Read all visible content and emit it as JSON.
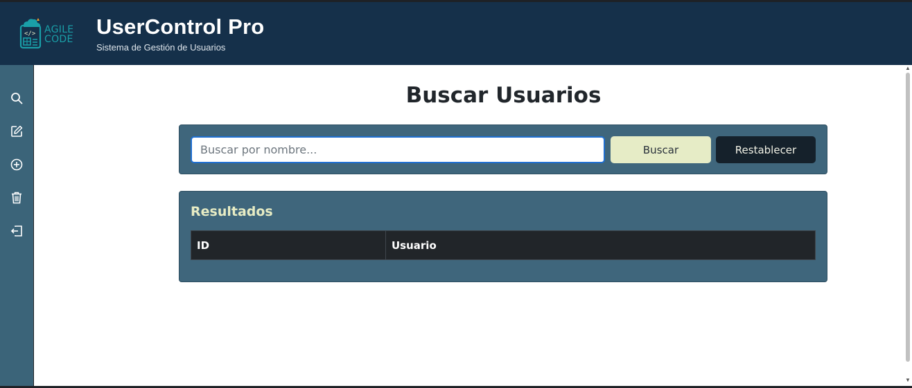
{
  "header": {
    "logo_line1": "AGILE",
    "logo_line2": "CODE",
    "title": "UserControl Pro",
    "subtitle": "Sistema de Gestión de Usuarios"
  },
  "sidebar": {
    "items": [
      {
        "icon": "search-icon"
      },
      {
        "icon": "edit-icon"
      },
      {
        "icon": "plus-circle-icon"
      },
      {
        "icon": "trash-icon"
      },
      {
        "icon": "logout-icon"
      }
    ]
  },
  "main": {
    "title": "Buscar Usuarios",
    "search": {
      "placeholder": "Buscar por nombre...",
      "value": "",
      "button_label": "Buscar",
      "reset_label": "Restablecer"
    },
    "results": {
      "title": "Resultados",
      "columns": [
        "ID",
        "Usuario"
      ],
      "rows": []
    }
  },
  "colors": {
    "header_bg": "#15304a",
    "sidebar_bg": "#3b6479",
    "panel_bg": "#3f667c",
    "accent_light": "#e6ecc6",
    "dark_button": "#15212b",
    "table_header": "#212529",
    "logo_teal": "#1a9fa8"
  }
}
